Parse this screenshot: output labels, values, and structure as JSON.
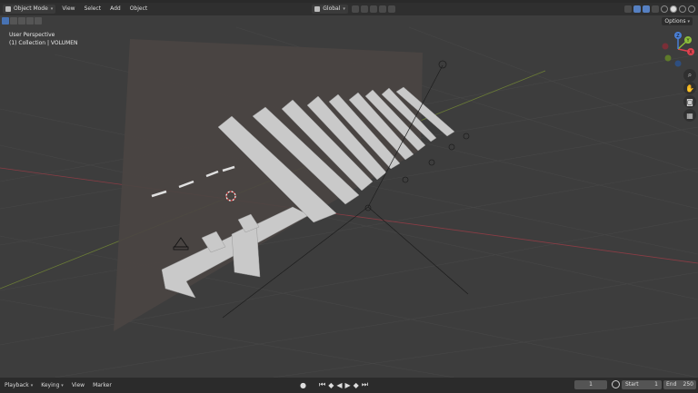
{
  "header": {
    "mode": "Object Mode",
    "menus": [
      "View",
      "Select",
      "Add",
      "Object"
    ],
    "transform_orientation": "Global"
  },
  "viewport": {
    "view_name": "User Perspective",
    "collection_line": "(1) Collection | VOLUMEN",
    "options_label": "Options"
  },
  "gizmo": {
    "x_label": "X",
    "y_label": "Y",
    "z_label": "Z"
  },
  "colors": {
    "x_axis": "#e0414f",
    "y_axis": "#8cbd3a",
    "z_axis": "#4a7fd6",
    "accent": "#4772b3"
  },
  "footer": {
    "playback": "Playback",
    "keying": "Keying",
    "view": "View",
    "marker": "Marker",
    "current_frame": "1",
    "start_label": "Start",
    "start_value": "1",
    "end_label": "End",
    "end_value": "250"
  }
}
